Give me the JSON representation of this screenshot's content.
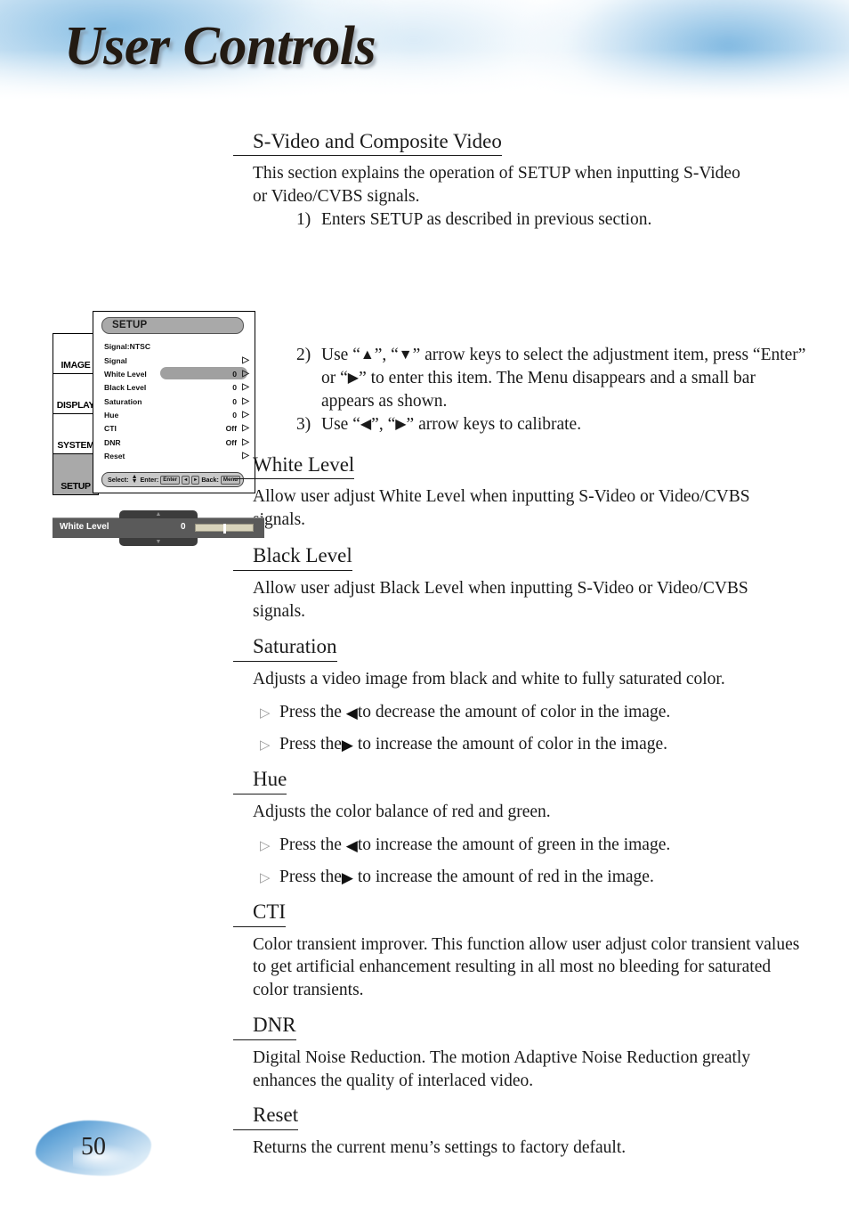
{
  "header": {
    "title": "User Controls"
  },
  "footer": {
    "page_number": "50"
  },
  "sections": [
    {
      "heading": "S-Video and Composite Video",
      "body": "This section explains the operation of SETUP when inputting S-Video or Video/CVBS signals."
    },
    {
      "heading": "White Level",
      "body": "Allow user adjust White Level when inputting S-Video or Video/CVBS signals."
    },
    {
      "heading": "Black Level",
      "body": "Allow user adjust Black Level when inputting S-Video or Video/CVBS signals."
    },
    {
      "heading": "Saturation",
      "body": "Adjusts a video image from black and white to fully saturated color.",
      "bullets": [
        {
          "before": "Press the ",
          "glyph": "◀",
          "after": "to decrease the amount of color in the image."
        },
        {
          "before": "Press the",
          "glyph": "▶",
          "after": " to increase the amount of color in the image."
        }
      ]
    },
    {
      "heading": "Hue",
      "body": "Adjusts the color balance of red and green.",
      "bullets": [
        {
          "before": "Press the ",
          "glyph": "◀",
          "after": "to increase the amount of green in the image."
        },
        {
          "before": "Press the",
          "glyph": "▶",
          "after": " to increase the amount of red in the image."
        }
      ]
    },
    {
      "heading": "CTI",
      "body": "Color transient improver. This function allow user adjust color transient values to get artificial enhancement resulting in all most no bleeding for saturated color transients."
    },
    {
      "heading": "DNR",
      "body": "Digital Noise Reduction. The motion Adaptive Noise Reduction greatly enhances the quality of interlaced video."
    },
    {
      "heading": "Reset",
      "body": "Returns the current menu’s settings to factory default."
    }
  ],
  "steps": {
    "step1": {
      "num": "1)",
      "text": "Enters SETUP as described in previous section."
    },
    "step2": {
      "num": "2)",
      "part_a": "Use “",
      "up": "▲",
      "part_b": "”, “",
      "down": "▼",
      "part_c": "” arrow keys to select the adjustment item, press “Enter” or “",
      "right": "▶",
      "part_d": "” to enter this item. The Menu disappears and a small bar appears as shown."
    },
    "step3": {
      "num": "3)",
      "part_a": "Use “",
      "left": "◀",
      "part_b": "”, “",
      "right": "▶",
      "part_c": "” arrow keys to calibrate."
    }
  },
  "osd": {
    "title": "SETUP",
    "tabs": [
      {
        "label": "IMAGE",
        "selected": false
      },
      {
        "label": "DISPLAY",
        "selected": false
      },
      {
        "label": "SYSTEM",
        "selected": false
      },
      {
        "label": "SETUP",
        "selected": true
      }
    ],
    "rows": [
      {
        "label": "Signal:NTSC",
        "value": "",
        "arrow": "",
        "highlighted": false
      },
      {
        "label": "Signal",
        "value": "",
        "arrow": "▷",
        "highlighted": false
      },
      {
        "label": "White Level",
        "value": "0",
        "arrow": "▷",
        "highlighted": true
      },
      {
        "label": "Black Level",
        "value": "0",
        "arrow": "▷",
        "highlighted": false
      },
      {
        "label": "Saturation",
        "value": "0",
        "arrow": "▷",
        "highlighted": false
      },
      {
        "label": "Hue",
        "value": "0",
        "arrow": "▷",
        "highlighted": false
      },
      {
        "label": "CTI",
        "value": "Off",
        "arrow": "▷",
        "highlighted": false
      },
      {
        "label": "DNR",
        "value": "Off",
        "arrow": "▷",
        "highlighted": false
      },
      {
        "label": "Reset",
        "value": "",
        "arrow": "▷",
        "highlighted": false
      }
    ],
    "footer": {
      "select_label": "Select:",
      "enter_label": "Enter:",
      "enter_key": "Enter",
      "left_key": "◂",
      "right_key": "▸",
      "back_label": "Back:",
      "back_key": "Menu",
      "up_glyph": "▲",
      "down_glyph": "▼"
    }
  },
  "white_level_bar": {
    "label": "White Level",
    "value": "0",
    "up_glyph": "▲",
    "down_glyph": "▼"
  }
}
